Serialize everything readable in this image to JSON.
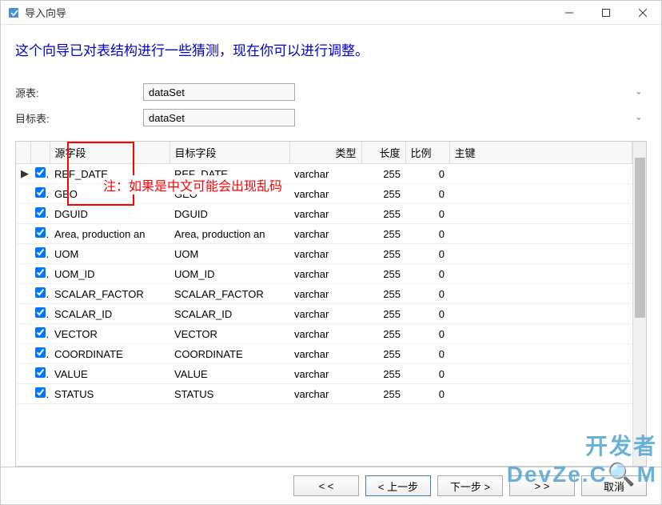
{
  "window": {
    "title": "导入向导"
  },
  "heading": "这个向导已对表结构进行一些猜测，现在你可以进行调整。",
  "form": {
    "source_label": "源表:",
    "source_value": "dataSet",
    "target_label": "目标表:",
    "target_value": "dataSet"
  },
  "annotation": "注：如果是中文可能会出现乱码",
  "columns": {
    "source_field": "源字段",
    "target_field": "目标字段",
    "type": "类型",
    "length": "长度",
    "scale": "比例",
    "primary_key": "主键"
  },
  "rows": [
    {
      "marker": "▶",
      "checked": true,
      "source": "REF_DATE",
      "target": "REF_DATE",
      "type": "varchar",
      "length": 255,
      "scale": 0,
      "pk": ""
    },
    {
      "marker": "",
      "checked": true,
      "source": "GEO",
      "target": "GEO",
      "type": "varchar",
      "length": 255,
      "scale": 0,
      "pk": ""
    },
    {
      "marker": "",
      "checked": true,
      "source": "DGUID",
      "target": "DGUID",
      "type": "varchar",
      "length": 255,
      "scale": 0,
      "pk": ""
    },
    {
      "marker": "",
      "checked": true,
      "source": "Area, production an",
      "target": "Area, production an",
      "type": "varchar",
      "length": 255,
      "scale": 0,
      "pk": ""
    },
    {
      "marker": "",
      "checked": true,
      "source": "UOM",
      "target": "UOM",
      "type": "varchar",
      "length": 255,
      "scale": 0,
      "pk": ""
    },
    {
      "marker": "",
      "checked": true,
      "source": "UOM_ID",
      "target": "UOM_ID",
      "type": "varchar",
      "length": 255,
      "scale": 0,
      "pk": ""
    },
    {
      "marker": "",
      "checked": true,
      "source": "SCALAR_FACTOR",
      "target": "SCALAR_FACTOR",
      "type": "varchar",
      "length": 255,
      "scale": 0,
      "pk": ""
    },
    {
      "marker": "",
      "checked": true,
      "source": "SCALAR_ID",
      "target": "SCALAR_ID",
      "type": "varchar",
      "length": 255,
      "scale": 0,
      "pk": ""
    },
    {
      "marker": "",
      "checked": true,
      "source": "VECTOR",
      "target": "VECTOR",
      "type": "varchar",
      "length": 255,
      "scale": 0,
      "pk": ""
    },
    {
      "marker": "",
      "checked": true,
      "source": "COORDINATE",
      "target": "COORDINATE",
      "type": "varchar",
      "length": 255,
      "scale": 0,
      "pk": ""
    },
    {
      "marker": "",
      "checked": true,
      "source": "VALUE",
      "target": "VALUE",
      "type": "varchar",
      "length": 255,
      "scale": 0,
      "pk": ""
    },
    {
      "marker": "",
      "checked": true,
      "source": "STATUS",
      "target": "STATUS",
      "type": "varchar",
      "length": 255,
      "scale": 0,
      "pk": ""
    }
  ],
  "buttons": {
    "first": "< <",
    "prev": "< 上一步",
    "next": "下一步 >",
    "last": "> >",
    "cancel": "取消"
  },
  "watermark": "开发者\nDevZe.C🔍M"
}
